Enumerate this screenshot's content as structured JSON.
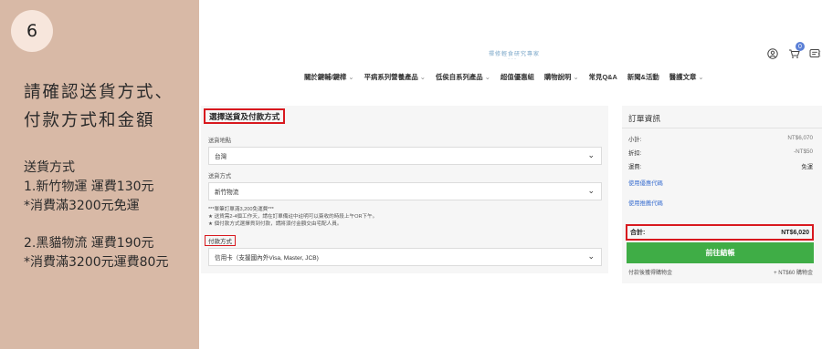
{
  "step": {
    "number": "6",
    "heading_line1": "請確認送貨方式、",
    "heading_line2": "付款方式和金額",
    "notes": {
      "title": "送貨方式",
      "opt1": "1.新竹物運 運費130元",
      "opt1_free": "*消費滿3200元免運",
      "opt2": "2.黑貓物流 運費190元",
      "opt2_discount": "*消費滿3200元運費80元"
    }
  },
  "header": {
    "logo_text": "禪修輕食研究專家",
    "cart_count": "0",
    "icons": [
      "user-icon",
      "cart-icon",
      "chat-icon"
    ]
  },
  "nav": {
    "items": [
      {
        "label": "關於鍵輔/鍵樟",
        "dropdown": true
      },
      {
        "label": "平病系列營養產品",
        "dropdown": true
      },
      {
        "label": "低侯自系列產品",
        "dropdown": true
      },
      {
        "label": "超值優惠組",
        "dropdown": false
      },
      {
        "label": "購物說明",
        "dropdown": true
      },
      {
        "label": "常見Q&A",
        "dropdown": false
      },
      {
        "label": "新聞&活動",
        "dropdown": false
      },
      {
        "label": "醫護文章",
        "dropdown": true
      }
    ]
  },
  "checkout": {
    "section_title": "選擇送貨及付款方式",
    "delivery_location_label": "送貨地點",
    "delivery_location_value": "台灣",
    "delivery_method_label": "送貨方式",
    "delivery_method_value": "新竹物流",
    "note1": "***單筆訂單滿3,200免運費***",
    "note2": "★ 送貨需2-4個工作天，請在訂單備註中註明可以簽收的時段上午OR下午。",
    "note3": "★ 個付款方式選擇貨到付款，請將須付金額交由宅配人員。",
    "payment_label": "付款方式",
    "payment_value": "信用卡（支援國內外Visa, Master, JCB)"
  },
  "summary": {
    "title": "訂單資訊",
    "subtotal_label": "小計:",
    "subtotal_value": "NT$6,070",
    "discount_label": "折扣:",
    "discount_value": "-NT$50",
    "shipping_label": "運費:",
    "shipping_value": "免運",
    "coupon_link": "使用優惠代碼",
    "referral_link": "使用推薦代碼",
    "total_label": "合計:",
    "total_value": "NT$6,020",
    "checkout_button": "前往結帳",
    "points_label": "付款後獲得購物金",
    "points_value": "+ NT$60 購物金"
  },
  "colors": {
    "left_panel": "#d8b9a6",
    "highlight": "#d8191f",
    "checkout_green": "#3fad46",
    "link_blue": "#3b6fd0"
  }
}
